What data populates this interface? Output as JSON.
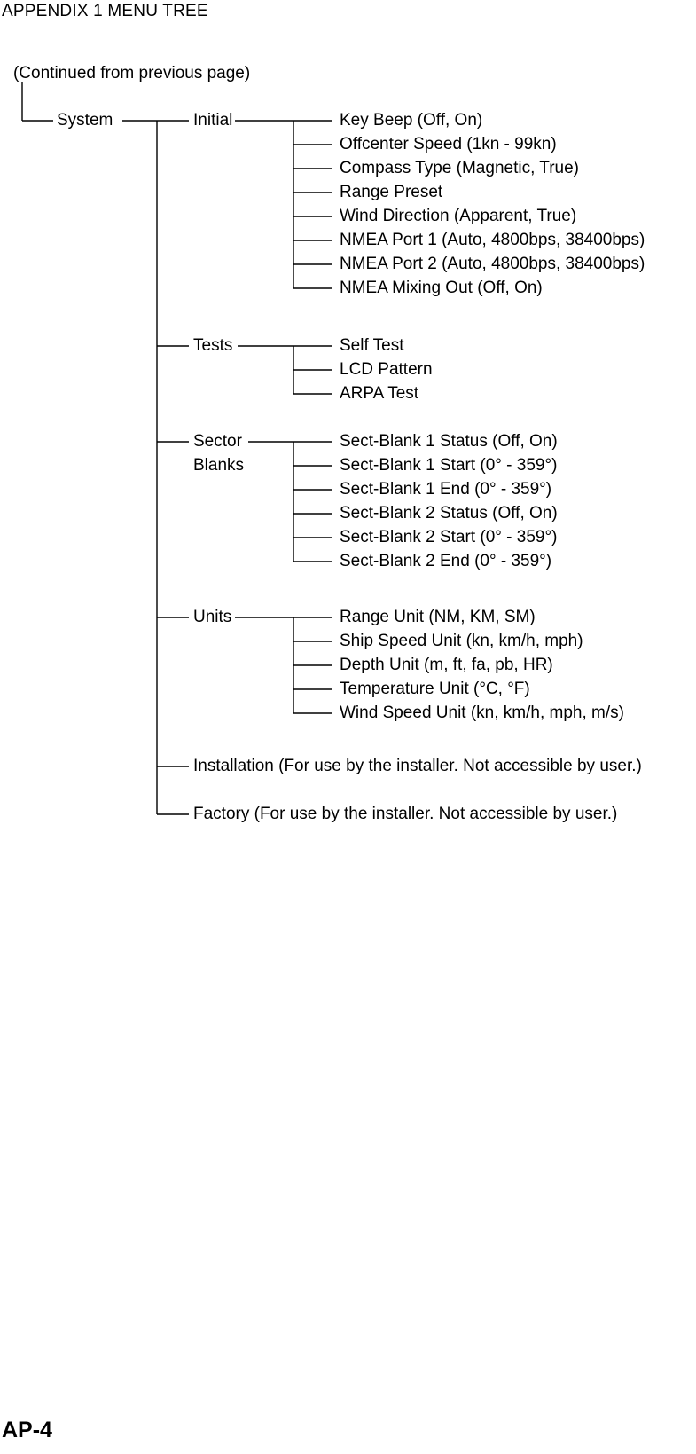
{
  "header": "APPENDIX 1 MENU TREE",
  "continued": "(Continued from previous page)",
  "pageNumber": "AP-4",
  "labels": {
    "system": "System",
    "initial": "Initial",
    "tests": "Tests",
    "sectorBlanks1": "Sector",
    "sectorBlanks2": "Blanks",
    "units": "Units",
    "installation": "Installation (For use by the installer. Not accessible by user.)",
    "factory": "Factory (For use by the installer. Not accessible by user.)",
    "initialItems": [
      "Key Beep (Off, On)",
      "Offcenter Speed (1kn - 99kn)",
      "Compass Type (Magnetic, True)",
      "Range Preset",
      "Wind Direction (Apparent, True)",
      "NMEA Port 1 (Auto, 4800bps, 38400bps)",
      "NMEA Port 2 (Auto, 4800bps, 38400bps)",
      "NMEA Mixing Out (Off, On)"
    ],
    "testsItems": [
      "Self Test",
      "LCD Pattern",
      "ARPA Test"
    ],
    "sectorItems": [
      "Sect-Blank 1 Status (Off, On)",
      "Sect-Blank 1 Start (0° - 359°)",
      "Sect-Blank 1 End (0° - 359°)",
      "Sect-Blank 2 Status (Off, On)",
      "Sect-Blank 2 Start (0° - 359°)",
      "Sect-Blank 2 End (0° - 359°)"
    ],
    "unitsItems": [
      "Range Unit (NM, KM, SM)",
      "Ship Speed Unit (kn, km/h, mph)",
      "Depth Unit (m, ft, fa, pb, HR)",
      "Temperature Unit (°C, °F)",
      "Wind Speed Unit (kn, km/h, mph, m/s)"
    ]
  }
}
